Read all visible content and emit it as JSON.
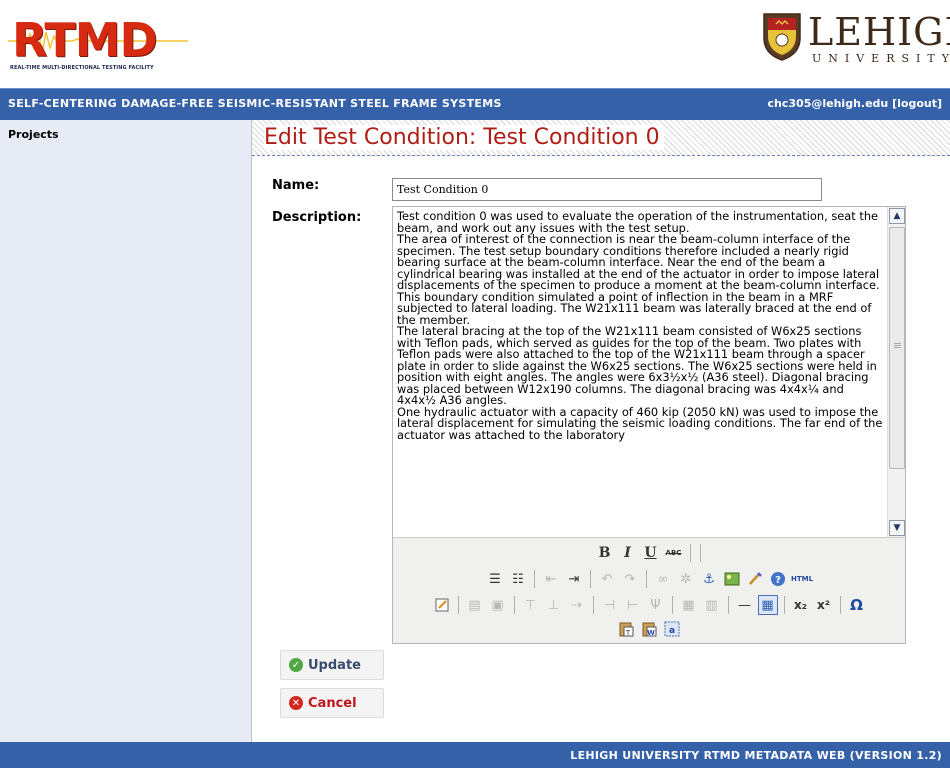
{
  "header": {
    "logo_text": "RTMD",
    "logo_subtitle": "REAL-TIME MULTI-DIRECTIONAL TESTING FACILITY",
    "university_name": "LEHIGH",
    "university_sub": "UNIVERSITY"
  },
  "topbar": {
    "project_title": "SELF-CENTERING DAMAGE-FREE SEISMIC-RESISTANT STEEL FRAME SYSTEMS",
    "user_email": "chc305@lehigh.edu",
    "logout_label": "[logout]"
  },
  "sidebar": {
    "items": [
      {
        "label": "Projects"
      }
    ]
  },
  "main": {
    "page_title": "Edit Test Condition: Test Condition 0",
    "name_label": "Name:",
    "name_value": "Test Condition 0",
    "description_label": "Description:",
    "description_paragraphs": [
      "Test condition 0 was used to evaluate the operation of the instrumentation, seat the beam, and work out any issues with the test setup.",
      "The area of interest of the connection is near the beam-column interface of the specimen. The test setup boundary conditions therefore included a nearly rigid bearing surface at the beam-column interface. Near the end of the beam a cylindrical bearing was installed at the end of the actuator in order to impose lateral displacements of the specimen to produce a moment at the beam-column interface. This boundary condition simulated a point of inflection in the beam in a MRF subjected to lateral loading. The W21x111 beam was laterally braced at the end of the member.",
      "The lateral bracing at the top of the W21x111 beam consisted of W6x25 sections with Teflon pads, which served as guides for the top of the beam. Two plates with Teflon pads were also attached to the top of the W21x111 beam through a spacer plate in order to slide against the W6x25 sections. The W6x25 sections were held in position with eight angles. The angles were 6x3½x½ (A36 steel). Diagonal bracing was placed between W12x190 columns. The diagonal bracing was 4x4x¼ and 4x4x½ A36 angles.",
      "One hydraulic actuator with a capacity of 460 kip (2050 kN) was used to impose the lateral displacement for simulating the seismic loading conditions. The far end of the actuator was attached to the laboratory"
    ],
    "toolbar": {
      "bold": "B",
      "italic": "I",
      "underline": "U",
      "strikethrough": "ABC",
      "html_label": "HTML",
      "subscript": "x₂",
      "superscript": "x²",
      "special_char": "Ω"
    },
    "update_label": "Update",
    "cancel_label": "Cancel"
  },
  "footer": {
    "text": "LEHIGH UNIVERSITY RTMD METADATA WEB (VERSION 1.2)"
  },
  "colors": {
    "bar_blue": "#3461a8",
    "title_red": "#b01d14",
    "sidebar_bg": "#e6ebf5"
  }
}
